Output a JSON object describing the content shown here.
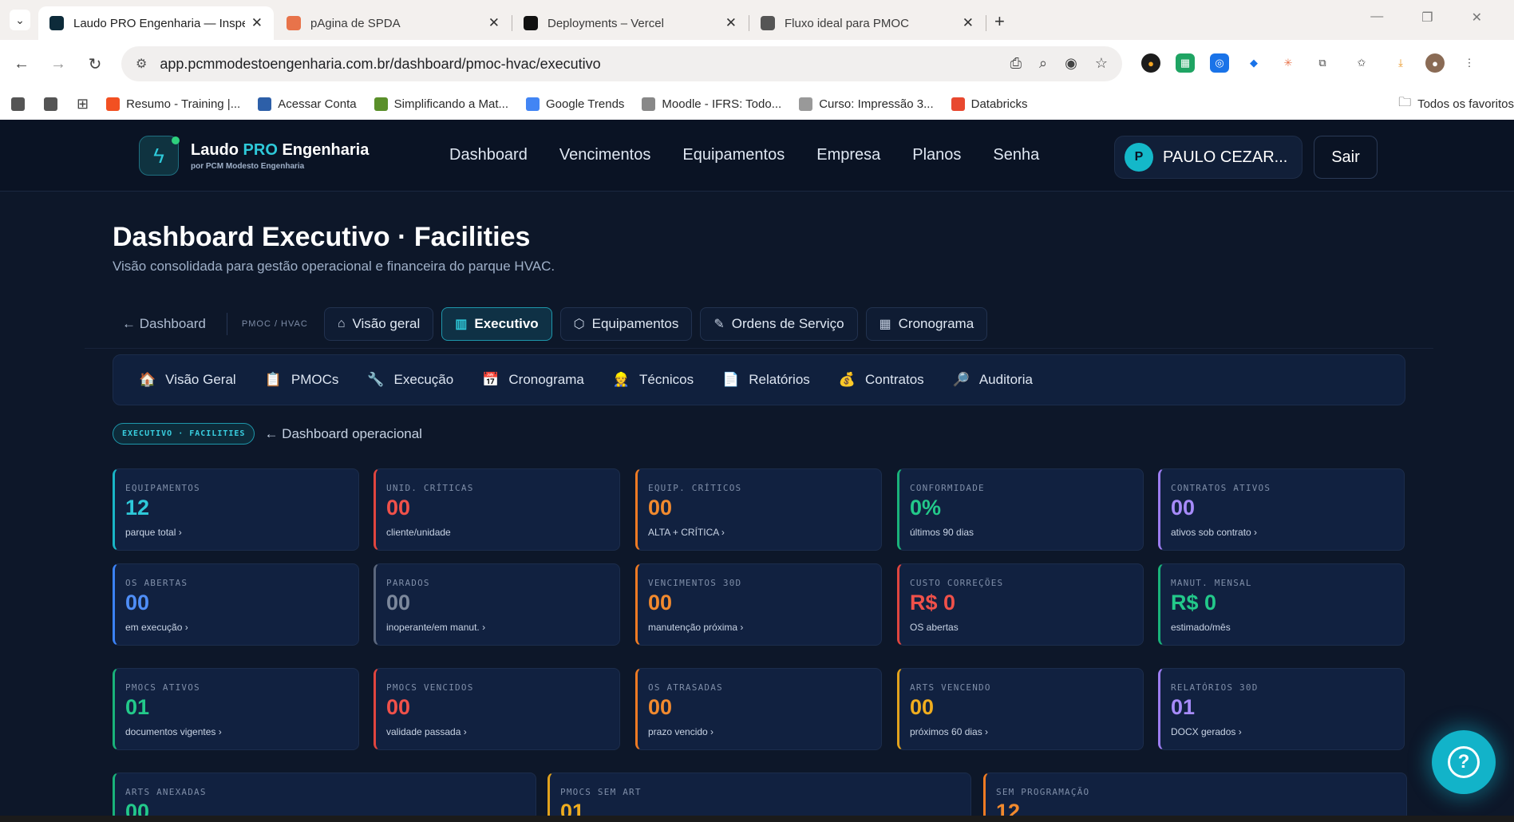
{
  "browser": {
    "tabs": [
      {
        "title": "Laudo PRO Engenharia — Inspe",
        "active": true,
        "favicon_color": "#0d2b3a"
      },
      {
        "title": "pAgina de SPDA",
        "active": false,
        "favicon_color": "#e8734a"
      },
      {
        "title": "Deployments – Vercel",
        "active": false,
        "favicon_color": "#111111"
      },
      {
        "title": "Fluxo ideal para PMOC",
        "active": false,
        "favicon_color": "#555555"
      }
    ],
    "close_glyph": "✕",
    "new_tab_glyph": "+",
    "url": "app.pcmmodestoengenharia.com.br/dashboard/pmoc-hvac/executivo",
    "bookmarks": [
      {
        "label": "Resumo - Training |...",
        "color": "#f25022"
      },
      {
        "label": "Acessar Conta",
        "color": "#2d5fa8"
      },
      {
        "label": "Simplificando a Mat...",
        "color": "#5a8f2a"
      },
      {
        "label": "Google Trends",
        "color": "#4285f4"
      },
      {
        "label": "Moodle - IFRS: Todo...",
        "color": "#888888"
      },
      {
        "label": "Curso: Impressão 3...",
        "color": "#999999"
      },
      {
        "label": "Databricks",
        "color": "#e8482f"
      }
    ],
    "all_bookmarks_label": "Todos os favoritos"
  },
  "header": {
    "brand_main": "Laudo ",
    "brand_pro": "PRO",
    "brand_rest": " Engenharia",
    "brand_sub": "por PCM Modesto Engenharia",
    "nav": [
      "Dashboard",
      "Vencimentos",
      "Equipamentos",
      "Empresa",
      "Planos",
      "Senha"
    ],
    "user_initial": "P",
    "user_name": "PAULO CEZAR...",
    "logout": "Sair"
  },
  "page": {
    "title": "Dashboard Executivo · Facilities",
    "subtitle": "Visão consolidada para gestão operacional e financeira do parque HVAC.",
    "back": "← Dashboard",
    "crumb": "PMOC / HVAC",
    "subnav": [
      {
        "icon": "⌂",
        "label": "Visão geral",
        "active": false
      },
      {
        "icon": "▥",
        "label": "Executivo",
        "active": true
      },
      {
        "icon": "⬡",
        "label": "Equipamentos",
        "active": false
      },
      {
        "icon": "✎",
        "label": "Ordens de Serviço",
        "active": false
      },
      {
        "icon": "▦",
        "label": "Cronograma",
        "active": false
      }
    ],
    "modules": [
      {
        "icon": "🏠",
        "label": "Visão Geral"
      },
      {
        "icon": "📋",
        "label": "PMOCs"
      },
      {
        "icon": "🔧",
        "label": "Execução"
      },
      {
        "icon": "📅",
        "label": "Cronograma"
      },
      {
        "icon": "👷",
        "label": "Técnicos"
      },
      {
        "icon": "📄",
        "label": "Relatórios"
      },
      {
        "icon": "💰",
        "label": "Contratos"
      },
      {
        "icon": "🔎",
        "label": "Auditoria"
      }
    ],
    "tag": "EXECUTIVO · FACILITIES",
    "tag_link": "← Dashboard operacional"
  },
  "kpis": [
    {
      "label": "EQUIPAMENTOS",
      "value": "12",
      "caption": "parque total ›",
      "color": "cyan"
    },
    {
      "label": "UNID. CRÍTICAS",
      "value": "00",
      "caption": "cliente/unidade",
      "color": "red"
    },
    {
      "label": "EQUIP. CRÍTICOS",
      "value": "00",
      "caption": "ALTA + CRÍTICA ›",
      "color": "orange"
    },
    {
      "label": "CONFORMIDADE",
      "value": "0%",
      "caption": "últimos 90 dias",
      "color": "green"
    },
    {
      "label": "CONTRATOS ATIVOS",
      "value": "00",
      "caption": "ativos sob contrato ›",
      "color": "purple"
    },
    {
      "label": "OS ABERTAS",
      "value": "00",
      "caption": "em execução ›",
      "color": "blue"
    },
    {
      "label": "PARADOS",
      "value": "00",
      "caption": "inoperante/em manut. ›",
      "color": "gray"
    },
    {
      "label": "VENCIMENTOS 30D",
      "value": "00",
      "caption": "manutenção próxima ›",
      "color": "orange"
    },
    {
      "label": "CUSTO CORREÇÕES",
      "value": "R$ 0",
      "caption": "OS abertas",
      "color": "red"
    },
    {
      "label": "MANUT. MENSAL",
      "value": "R$ 0",
      "caption": "estimado/mês",
      "color": "green"
    },
    {
      "label": "PMOCS ATIVOS",
      "value": "01",
      "caption": "documentos vigentes ›",
      "color": "green"
    },
    {
      "label": "PMOCS VENCIDOS",
      "value": "00",
      "caption": "validade passada ›",
      "color": "red"
    },
    {
      "label": "OS ATRASADAS",
      "value": "00",
      "caption": "prazo vencido ›",
      "color": "orange"
    },
    {
      "label": "ARTS VENCENDO",
      "value": "00",
      "caption": "próximos 60 dias ›",
      "color": "amber"
    },
    {
      "label": "RELATÓRIOS 30D",
      "value": "01",
      "caption": "DOCX gerados ›",
      "color": "purple"
    },
    {
      "label": "ARTS ANEXADAS",
      "value": "00",
      "caption": "",
      "color": "green"
    },
    {
      "label": "PMOCS SEM ART",
      "value": "01",
      "caption": "",
      "color": "amber"
    },
    {
      "label": "SEM PROGRAMAÇÃO",
      "value": "12",
      "caption": "",
      "color": "orange"
    }
  ],
  "help_glyph": "?"
}
